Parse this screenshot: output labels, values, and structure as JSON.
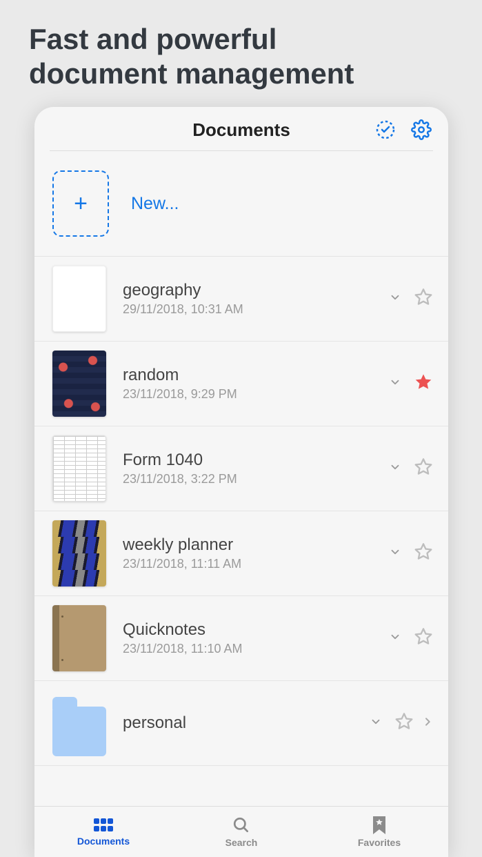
{
  "marketing": {
    "line1": "Fast and powerful",
    "line2": "document management"
  },
  "header": {
    "title": "Documents"
  },
  "newAction": {
    "label": "New..."
  },
  "documents": [
    {
      "title": "geography",
      "date": "29/11/2018, 10:31 AM",
      "fav": false,
      "thumb": "blank"
    },
    {
      "title": "random",
      "date": "23/11/2018, 9:29 PM",
      "fav": true,
      "thumb": "navy"
    },
    {
      "title": "Form 1040",
      "date": "23/11/2018, 3:22 PM",
      "fav": false,
      "thumb": "form"
    },
    {
      "title": "weekly planner",
      "date": "23/11/2018, 11:11 AM",
      "fav": false,
      "thumb": "stripes"
    },
    {
      "title": "Quicknotes",
      "date": "23/11/2018, 11:10 AM",
      "fav": false,
      "thumb": "tan"
    },
    {
      "title": "personal",
      "date": "",
      "fav": false,
      "thumb": "folder",
      "isFolder": true
    }
  ],
  "tabs": {
    "documents": "Documents",
    "search": "Search",
    "favorites": "Favorites"
  },
  "colors": {
    "accent": "#1477e6",
    "tabActive": "#1356d6",
    "favStar": "#ec5252"
  }
}
